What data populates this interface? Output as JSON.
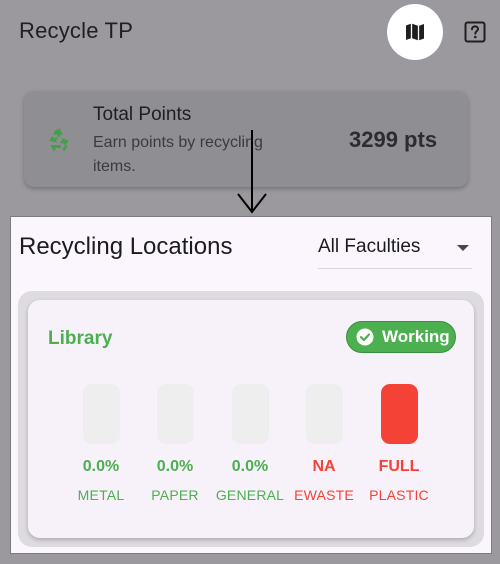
{
  "appbar": {
    "title": "Recycle TP",
    "map_icon": "map-icon",
    "help_icon": "help-icon"
  },
  "points_card": {
    "title": "Total Points",
    "description": "Earn points by recycling items.",
    "value": "3299 pts",
    "icon": "recycle-icon",
    "icon_color": "#43a047"
  },
  "locations": {
    "title": "Recycling Locations",
    "faculty_filter": "All Faculties",
    "card": {
      "name": "Library",
      "status": "Working",
      "status_color": "#4caf50",
      "bins": [
        {
          "level": "0.0%",
          "type": "METAL",
          "fill": 0,
          "state": "ok"
        },
        {
          "level": "0.0%",
          "type": "PAPER",
          "fill": 0,
          "state": "ok"
        },
        {
          "level": "0.0%",
          "type": "GENERAL",
          "fill": 0,
          "state": "ok"
        },
        {
          "level": "NA",
          "type": "EWASTE",
          "fill": 0,
          "state": "na"
        },
        {
          "level": "FULL",
          "type": "PLASTIC",
          "fill": 1,
          "state": "full"
        }
      ]
    }
  },
  "colors": {
    "ok": "#4caf50",
    "alert": "#f44336",
    "bin_empty": "#eeeeee"
  }
}
